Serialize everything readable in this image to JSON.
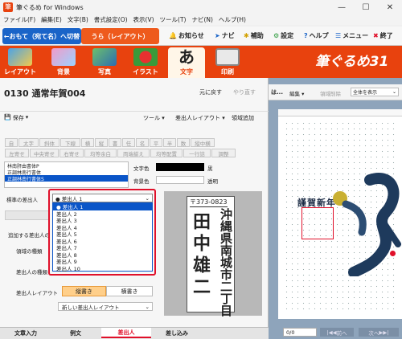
{
  "window": {
    "title": "筆ぐるめ for Windows",
    "minimize": "—",
    "maximize": "☐",
    "close": "✕"
  },
  "menu": [
    "ファイル(F)",
    "編集(E)",
    "文字(B)",
    "書式設定(O)",
    "表示(V)",
    "ツール(T)",
    "ナビ(N)",
    "ヘルプ(H)"
  ],
  "mode_tabs": {
    "front": "←おもて（宛て名）へ切替",
    "back": "うら（レイアウト）"
  },
  "top_tools": {
    "notice": "お知らせ",
    "navi": "ナビ",
    "assist": "補助",
    "settings": "設定",
    "help": "ヘルプ",
    "menu": "メニュー",
    "exit": "終了"
  },
  "ribbon": {
    "layout": "レイアウト",
    "background": "背景",
    "photo": "写真",
    "illust": "イラスト",
    "text": "文字",
    "print": "印刷",
    "brand": "筆ぐるめ31"
  },
  "left": {
    "doc_name": "0130 通常年賀004",
    "undo": "元に戻す",
    "redo": "やり直す",
    "save": "保存",
    "tools": "ツール",
    "sender_layout": "差出人レイアウト",
    "area_add": "領域追加",
    "fmt1": [
      "自",
      "太字",
      "斜体",
      "下線",
      "横",
      "縦",
      "書",
      "任",
      "名",
      "平",
      "半",
      "数",
      "縦中横"
    ],
    "fmt2": [
      "左寄せ",
      "中央寄せ",
      "右寄せ",
      "均等余白",
      "両端揃え",
      "均等配置",
      "一行詰",
      "調整"
    ],
    "list_items": [
      "林南肝由書体P",
      "正調林南行書体",
      "正調林南行書体S"
    ],
    "text_color_label": "文字色",
    "text_color_value": "黒",
    "bg_color_label": "背景色",
    "bg_color_value": "透明",
    "std_sender_label": "標準の差出人",
    "dropdown_value": "● 差出人 1",
    "options": [
      "● 差出人 1",
      "差出人 2",
      "差出人 3",
      "差出人 4",
      "差出人 5",
      "差出人 6",
      "差出人 7",
      "差出人 8",
      "差出人 9",
      "差出人 10"
    ],
    "add_sender_label": "追加する差出人の",
    "area_type_label": "領域の種類",
    "sender_kind_label": "差出人の種類",
    "sender_layout_label": "差出人レイアウト",
    "tate": "縦書き",
    "yoko": "横書き",
    "new_layout": "新しい差出人レイアウト",
    "postal": "〒373-0823",
    "address1": "沖縄県南城市二丁目",
    "name": "田中雄二"
  },
  "bottom_tabs": [
    "文章入力",
    "例文",
    "差出人",
    "差し込み"
  ],
  "right": {
    "toolbar_label": "は...",
    "edit": "編集",
    "area_delete": "領域削除",
    "zoom": "全体を表示",
    "greeting": "謹賀新年",
    "page_counter": "0/0",
    "prev": "前へ",
    "next": "次へ"
  },
  "colors": {
    "accent": "#e8420e",
    "blue": "#1a64c8",
    "highlight": "#0a55c8",
    "red_frame": "#e0102a"
  }
}
